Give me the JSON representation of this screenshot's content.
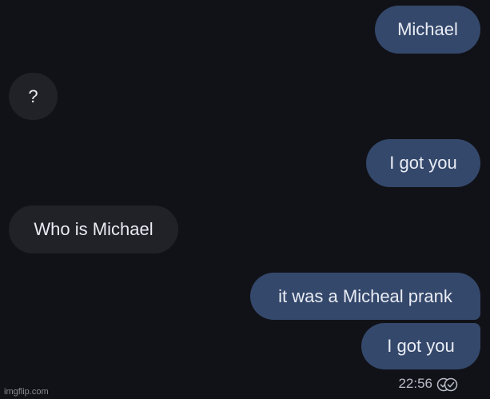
{
  "messages": [
    {
      "direction": "sent",
      "text": "Michael"
    },
    {
      "direction": "received",
      "text": "?"
    },
    {
      "direction": "sent",
      "text": "I got you"
    },
    {
      "direction": "received",
      "text": "Who is Michael"
    },
    {
      "direction": "sent",
      "text": "it was a Micheal prank"
    },
    {
      "direction": "sent",
      "text": "I got you"
    }
  ],
  "last_message_time": "22:56",
  "read_status_icon": "double-check-circle-icon",
  "watermark": "imgflip.com",
  "colors": {
    "background": "#111218",
    "sent_bubble": "#34486b",
    "received_bubble": "#212227",
    "text": "#e9ecf4",
    "meta_text": "#b9bdc8"
  }
}
